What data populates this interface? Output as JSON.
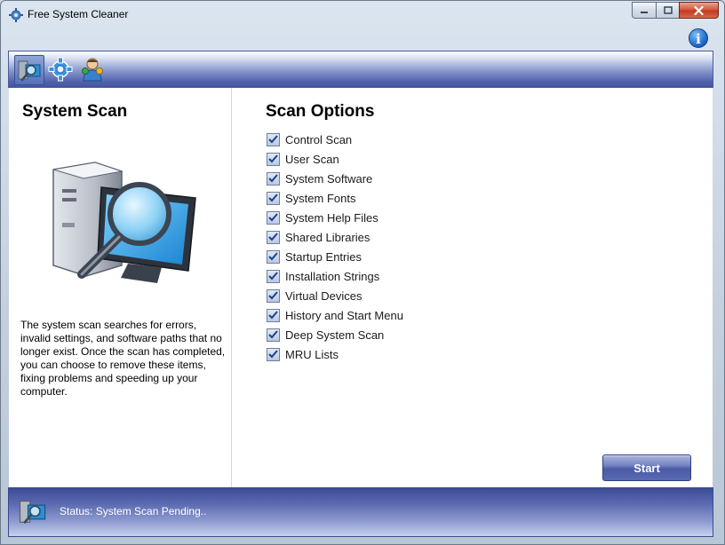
{
  "window": {
    "title": "Free System Cleaner"
  },
  "toolbar": {
    "items": [
      {
        "icon": "system-scan-icon",
        "active": true
      },
      {
        "icon": "gear-icon",
        "active": false
      },
      {
        "icon": "users-icon",
        "active": false
      }
    ]
  },
  "left_panel": {
    "title": "System Scan",
    "illustration_icon": "computer-magnifier-icon",
    "description": "The system scan searches for errors, invalid settings, and software paths that no longer exist. Once the scan has completed, you can choose to remove these items, fixing problems and speeding up your computer."
  },
  "right_panel": {
    "title": "Scan Options",
    "options": [
      {
        "label": "Control Scan",
        "checked": true
      },
      {
        "label": "User Scan",
        "checked": true
      },
      {
        "label": "System Software",
        "checked": true
      },
      {
        "label": "System Fonts",
        "checked": true
      },
      {
        "label": "System Help Files",
        "checked": true
      },
      {
        "label": "Shared Libraries",
        "checked": true
      },
      {
        "label": "Startup Entries",
        "checked": true
      },
      {
        "label": "Installation Strings",
        "checked": true
      },
      {
        "label": "Virtual Devices",
        "checked": true
      },
      {
        "label": "History and Start Menu",
        "checked": true
      },
      {
        "label": "Deep System Scan",
        "checked": true
      },
      {
        "label": "MRU Lists",
        "checked": true
      }
    ],
    "start_label": "Start"
  },
  "status": {
    "text": "Status: System Scan Pending.."
  },
  "colors": {
    "toolbar_blue": "#5162ad",
    "close_red": "#c23b20",
    "check_blue": "#1f3f8a"
  }
}
